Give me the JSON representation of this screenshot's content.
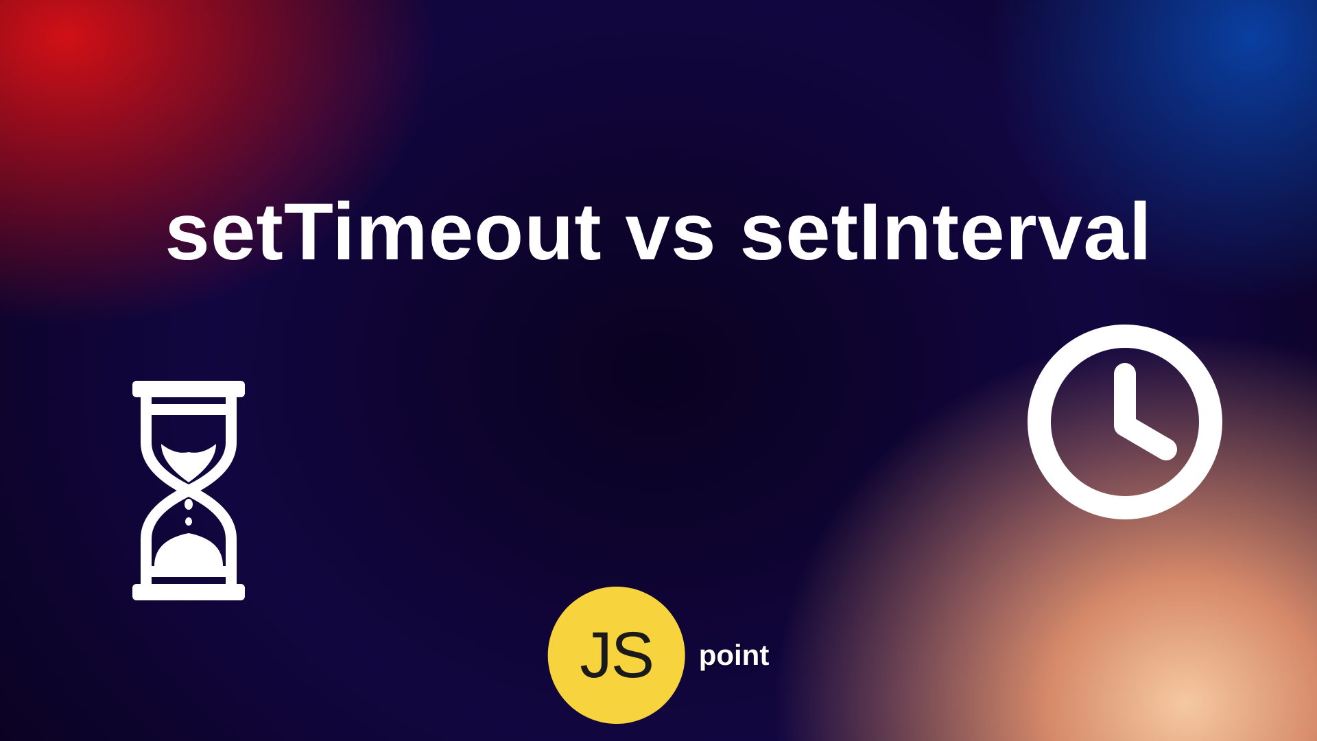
{
  "title": "setTimeout vs setInterval",
  "logo": {
    "badge": "JS",
    "text": "point"
  }
}
